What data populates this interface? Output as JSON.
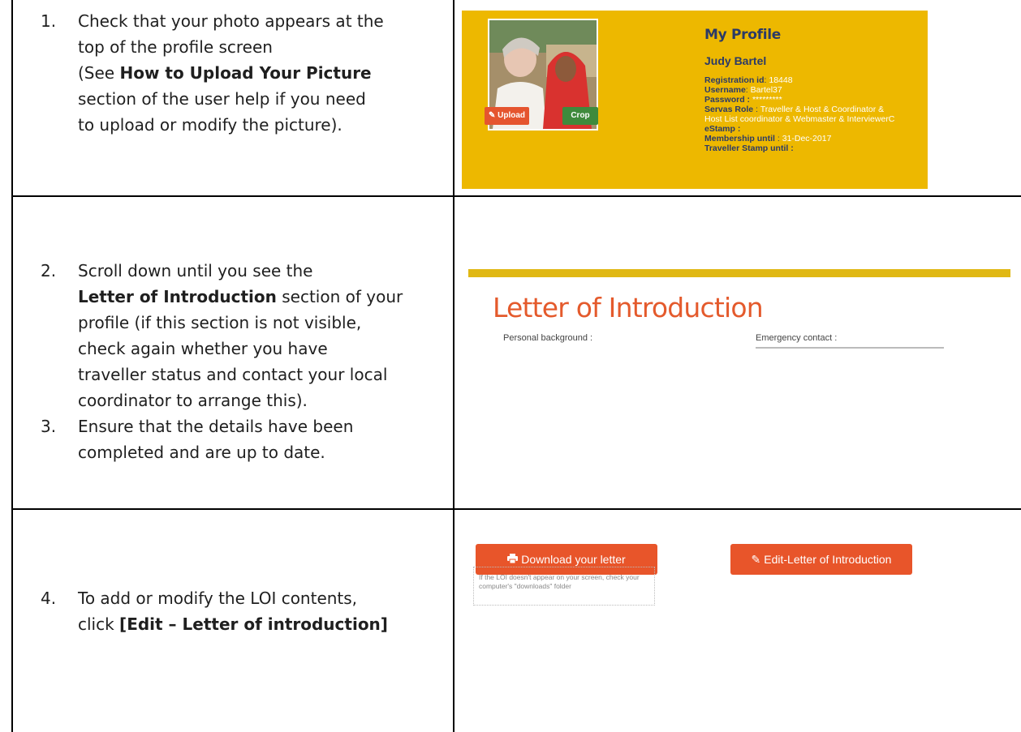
{
  "steps": [
    {
      "num": "1.",
      "l1": "Check that your photo appears at the",
      "l2": "top of the profile screen",
      "l3a": "(See ",
      "l3b": "How to Upload Your Picture",
      "l4": "section of the user help if you need",
      "l5": "to upload or modify the picture)."
    },
    {
      "num": "2.",
      "l1": "Scroll down until you see the",
      "l2b": "Letter of Introduction",
      "l2": " section of your",
      "l3": "profile (if this section is not visible,",
      "l4": "check again whether you have",
      "l5": "traveller status and contact your local",
      "l6": "coordinator to arrange this)."
    },
    {
      "num": "3.",
      "l1": "Ensure that the details have been",
      "l2": "completed and are up to date."
    },
    {
      "num": "4.",
      "l1": "To add or modify the LOI contents,",
      "l2a": "click ",
      "l2b": "[Edit – Letter of introduction]"
    }
  ],
  "profile": {
    "title": "My Profile",
    "name": "Judy Bartel",
    "upload_label": "Upload",
    "crop_label": "Crop",
    "fields": [
      {
        "label": "Registration id",
        "sep": ": ",
        "value": "18448"
      },
      {
        "label": "Username",
        "sep": ": ",
        "value": "Bartel37"
      },
      {
        "label": "Password",
        "sep": " : ",
        "value": "*********"
      },
      {
        "label": "Servas Role",
        "sep": " : ",
        "value": "Traveller & Host & Coordinator & Host List coordinator & Webmaster & InterviewerC"
      },
      {
        "label": "eStamp",
        "sep": " : ",
        "value": ""
      },
      {
        "label": "Membership until",
        "sep": " : ",
        "value": "31-Dec-2017"
      },
      {
        "label": "Traveller Stamp until",
        "sep": " : ",
        "value": ""
      }
    ],
    "colors": {
      "background": "#edb800",
      "text": "#2b3a67",
      "upload": "#e5552f",
      "crop": "#3f8a3c"
    }
  },
  "loi": {
    "title": "Letter of Introduction",
    "personal_background": "Personal background :",
    "emergency_contact": "Emergency contact :",
    "colors": {
      "title": "#e45a2c",
      "bar": "#e0b814"
    }
  },
  "actions": {
    "download_label": "Download your letter",
    "download_icon": "printer-icon",
    "edit_label": "Edit-Letter of Introduction",
    "edit_icon": "pencil-icon",
    "note": "If the LOI doesn't appear on your screen, check your computer's \"downloads\" folder",
    "color": "#e8552a"
  }
}
